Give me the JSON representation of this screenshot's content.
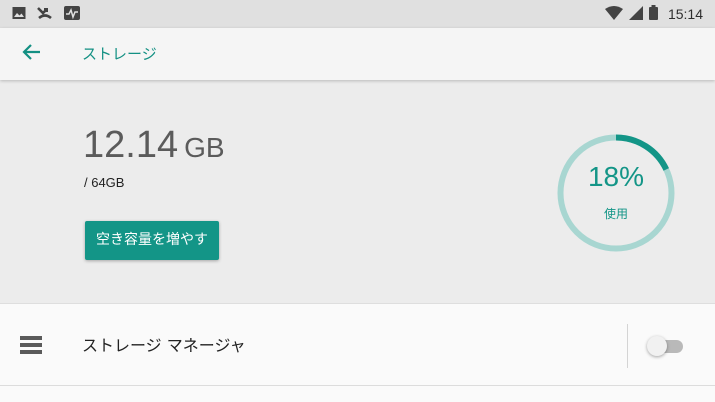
{
  "status_bar": {
    "time": "15:14",
    "left_icons": [
      "image-icon",
      "missed-call-icon",
      "activity-icon"
    ],
    "right_icons": [
      "wifi-icon",
      "cell-signal-icon",
      "battery-icon"
    ]
  },
  "app_bar": {
    "back_icon": "arrow-left-icon",
    "title": "ストレージ"
  },
  "storage": {
    "used_value": "12.14",
    "used_unit": "GB",
    "total": "/ 64GB",
    "free_up_button": "空き容量を増やす",
    "percent_used": 18,
    "percent_text": "18%",
    "percent_label": "使用"
  },
  "storage_manager": {
    "icon": "list-icon",
    "label": "ストレージ マネージャ",
    "enabled": false
  },
  "colors": {
    "accent": "#139587",
    "ring_track": "#a8d6d1",
    "status_bar_bg": "#e0e0e0",
    "app_bar_bg": "#f5f5f5",
    "summary_bg": "#ececec"
  }
}
